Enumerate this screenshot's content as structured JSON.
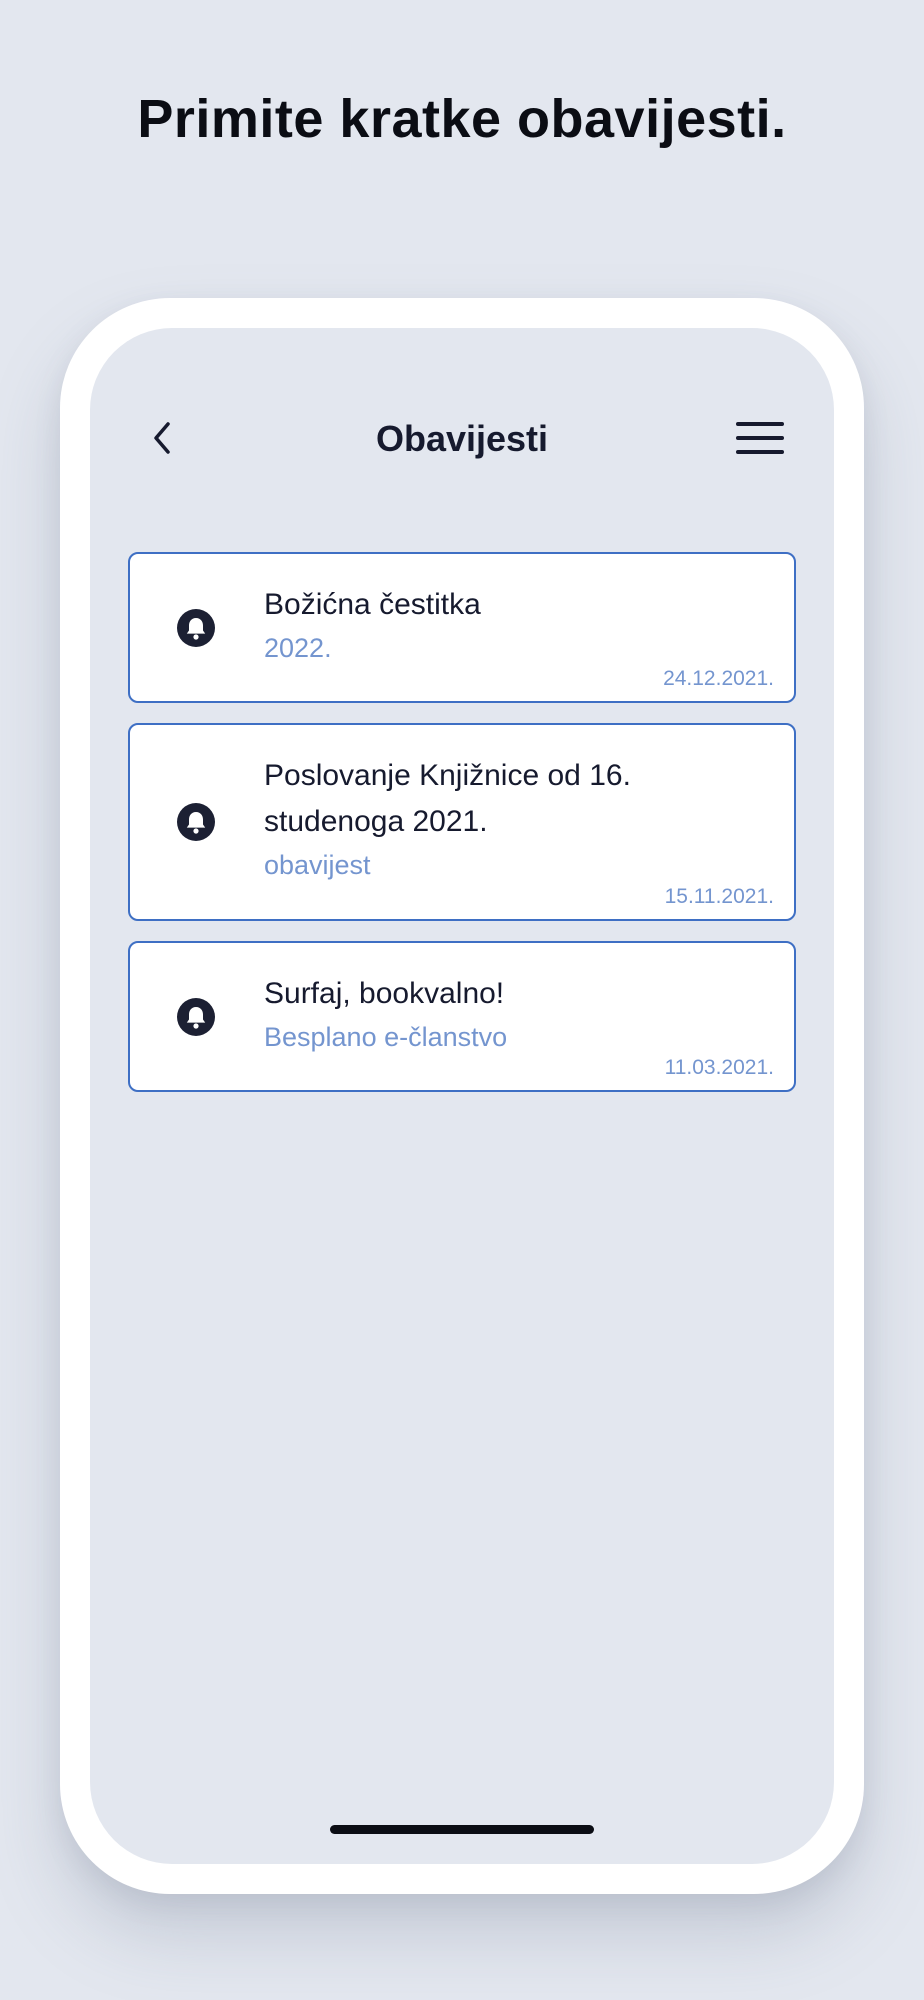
{
  "headline": "Primite kratke obavijesti.",
  "nav": {
    "title": "Obavijesti",
    "back_icon": "chevron-left-icon",
    "menu_icon": "hamburger-menu-icon"
  },
  "notifications": [
    {
      "title": "Božićna čestitka",
      "subtitle": "2022.",
      "date": "24.12.2021.",
      "icon": "bell-icon"
    },
    {
      "title": "Poslovanje Knjižnice od 16. studenoga 2021.",
      "subtitle": "obavijest",
      "date": "15.11.2021.",
      "icon": "bell-icon"
    },
    {
      "title": "Surfaj, bookvalno!",
      "subtitle": "Besplano e-članstvo",
      "date": "11.03.2021.",
      "icon": "bell-icon"
    }
  ],
  "colors": {
    "background": "#e3e7ef",
    "card_border": "#3e6fc4",
    "accent_text": "#7495cf",
    "primary_text": "#161a2e"
  }
}
